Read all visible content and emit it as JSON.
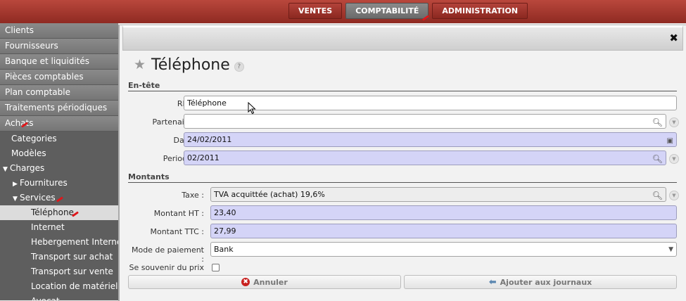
{
  "topnav": {
    "items": [
      "VENTES",
      "COMPTABILITÉ",
      "ADMINISTRATION"
    ]
  },
  "sidebar": {
    "sections": [
      "Clients",
      "Fournisseurs",
      "Banque et liquidités",
      "Pièces comptables",
      "Plan comptable",
      "Traitements périodiques",
      "Achats"
    ],
    "achats": {
      "categories": "Categories",
      "modeles": "Modèles",
      "charges": "Charges",
      "fournitures": "Fournitures",
      "services": "Services",
      "services_items": [
        "Téléphone",
        "Internet",
        "Hebergement Internet",
        "Transport sur achat",
        "Transport sur vente",
        "Location de matériel p",
        "Avocat"
      ]
    }
  },
  "dialog": {
    "title": "Téléphone",
    "help": "?",
    "close": "✖",
    "section_entete": "En-tête",
    "section_montants": "Montants",
    "fields": {
      "ref": {
        "label": "REF :",
        "value": "Téléphone"
      },
      "partenaire": {
        "label": "Partenaire :",
        "value": ""
      },
      "date": {
        "label": "Date :",
        "value": "24/02/2011"
      },
      "periode": {
        "label": "Periode :",
        "value": "02/2011"
      },
      "taxe": {
        "label": "Taxe :",
        "value": "TVA acquittée (achat) 19,6%"
      },
      "montant_ht": {
        "label": "Montant HT :",
        "value": "23,40"
      },
      "montant_ttc": {
        "label": "Montant TTC :",
        "value": "27,99"
      },
      "mode_paiement": {
        "label": "Mode de paiement :",
        "value": "Bank"
      },
      "souvenir": {
        "label": "Se souvenir du prix :"
      }
    },
    "buttons": {
      "cancel": "Annuler",
      "add": "Ajouter aux journaux"
    }
  },
  "colors": {
    "topbar": "#a6362d",
    "readonly_field": "#d4d4f7",
    "mark": "#e0161a"
  }
}
